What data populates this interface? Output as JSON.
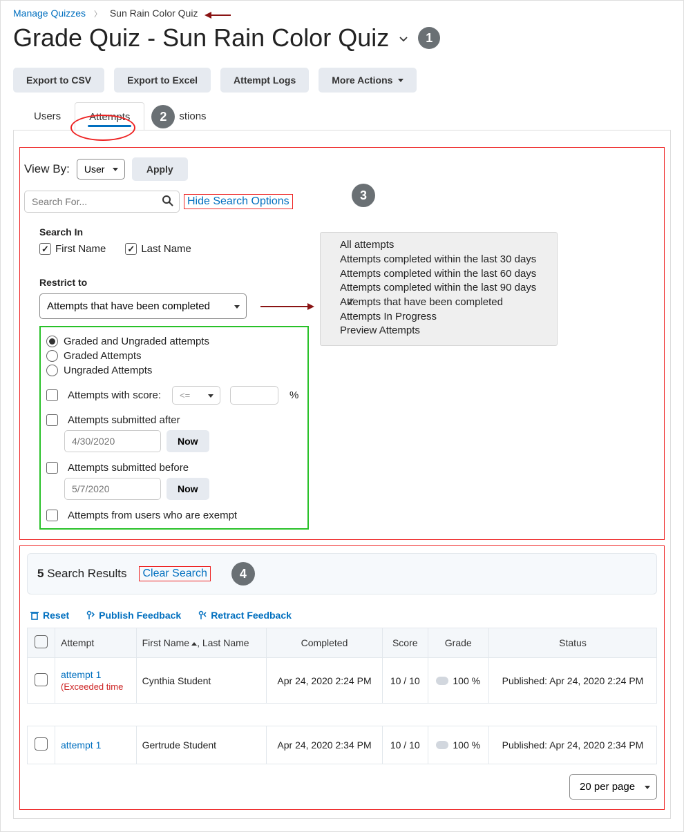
{
  "breadcrumb": {
    "root": "Manage Quizzes",
    "current": "Sun Rain Color Quiz"
  },
  "page_title": "Grade Quiz - Sun Rain Color Quiz",
  "steps": {
    "s1": "1",
    "s2": "2",
    "s3": "3",
    "s4": "4"
  },
  "actions": {
    "export_csv": "Export to CSV",
    "export_excel": "Export to Excel",
    "attempt_logs": "Attempt Logs",
    "more": "More Actions"
  },
  "tabs": {
    "users": "Users",
    "attempts": "Attempts",
    "questions": "stions",
    "active": "Attempts"
  },
  "viewby": {
    "label": "View By:",
    "value": "User",
    "apply": "Apply"
  },
  "search": {
    "placeholder": "Search For...",
    "hide_opts": "Hide Search Options"
  },
  "search_in": {
    "heading": "Search In",
    "first": {
      "label": "First Name",
      "checked": true
    },
    "last": {
      "label": "Last Name",
      "checked": true
    }
  },
  "restrict": {
    "heading": "Restrict to",
    "value": "Attempts that have been completed",
    "options": [
      "All attempts",
      "Attempts completed within the last 30 days",
      "Attempts completed within the last 60 days",
      "Attempts completed within the last 90 days",
      "Attempts that have been completed",
      "Attempts In Progress",
      "Preview Attempts"
    ],
    "selected_idx": 4
  },
  "filters": {
    "graded_radio": {
      "both": "Graded and Ungraded attempts",
      "graded": "Graded Attempts",
      "ungraded": "Ungraded Attempts",
      "value": "both"
    },
    "score": {
      "label": "Attempts with score:",
      "op": "<=",
      "pct": "%"
    },
    "after": {
      "label": "Attempts submitted after",
      "date": "4/30/2020",
      "now": "Now"
    },
    "before": {
      "label": "Attempts submitted before",
      "date": "5/7/2020",
      "now": "Now"
    },
    "exempt": {
      "label": "Attempts from users who are exempt"
    }
  },
  "results": {
    "count": "5",
    "label": "Search Results",
    "clear": "Clear Search"
  },
  "table_actions": {
    "reset": "Reset",
    "publish": "Publish Feedback",
    "retract": "Retract Feedback"
  },
  "columns": {
    "attempt": "Attempt",
    "name": "First Name",
    "name2": ", Last Name",
    "completed": "Completed",
    "score": "Score",
    "grade": "Grade",
    "status": "Status"
  },
  "rows": [
    {
      "attempt": "attempt 1",
      "note": "(Exceeded time",
      "name": "Cynthia Student",
      "completed": "Apr 24, 2020 2:24 PM",
      "score": "10 / 10",
      "grade": "100 %",
      "status": "Published: Apr 24, 2020 2:24 PM"
    },
    {
      "attempt": "attempt 1",
      "note": "",
      "name": "Gertrude Student",
      "completed": "Apr 24, 2020 2:34 PM",
      "score": "10 / 10",
      "grade": "100 %",
      "status": "Published: Apr 24, 2020 2:34 PM"
    }
  ],
  "pager": {
    "value": "20 per page"
  }
}
